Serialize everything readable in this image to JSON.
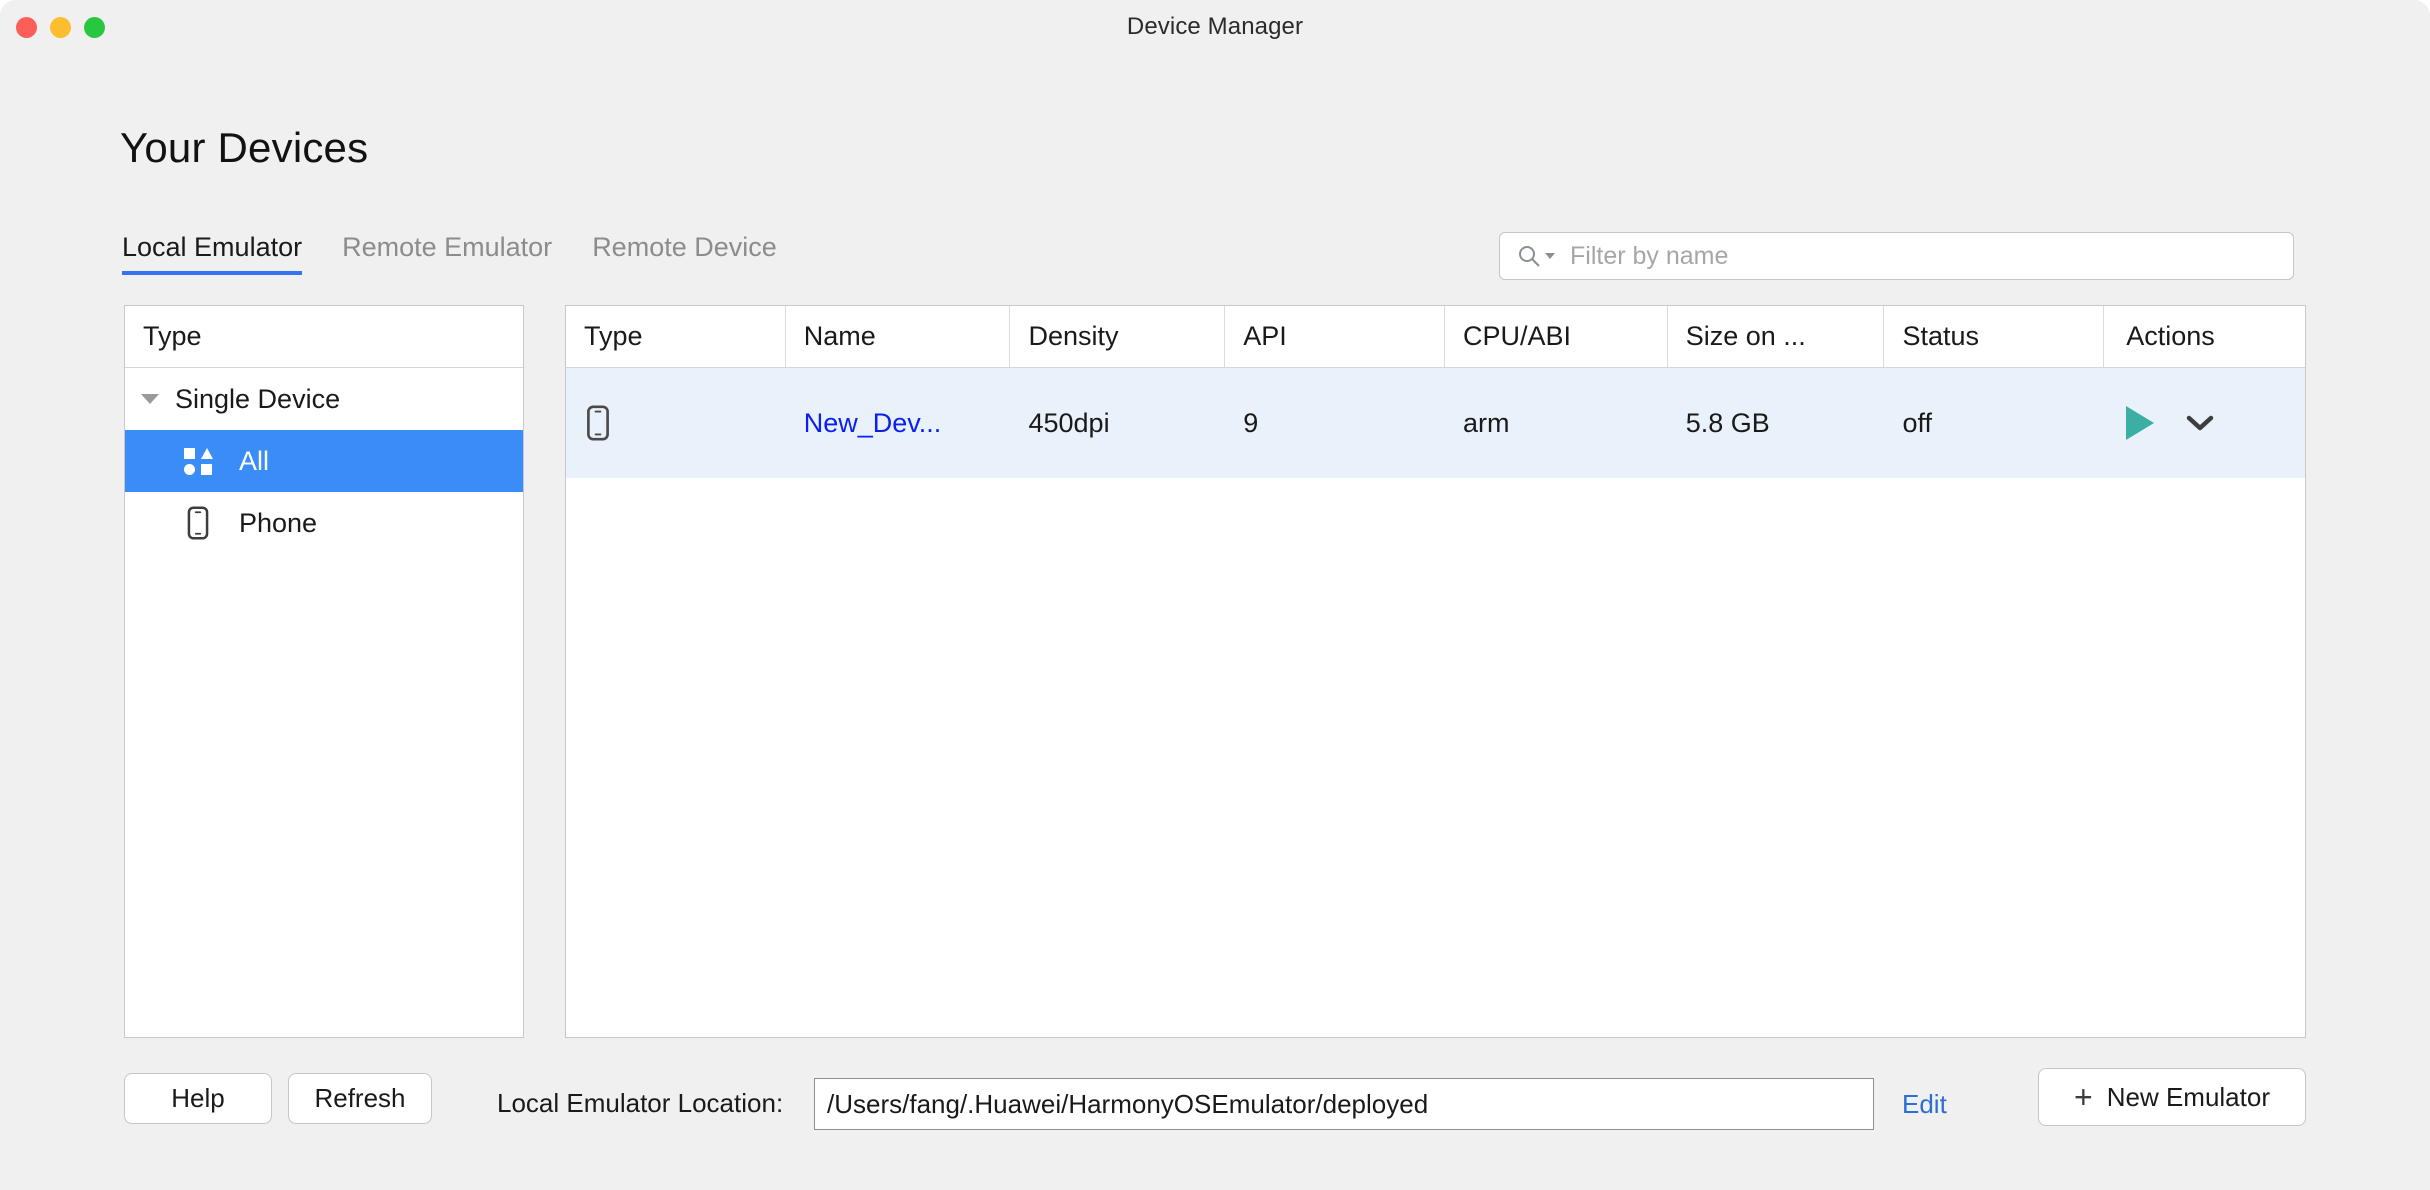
{
  "window": {
    "title": "Device Manager",
    "traffic_lights": [
      "close",
      "minimize",
      "maximize"
    ]
  },
  "page": {
    "heading": "Your Devices"
  },
  "tabs": [
    {
      "label": "Local Emulator",
      "active": true
    },
    {
      "label": "Remote Emulator",
      "active": false
    },
    {
      "label": "Remote Device",
      "active": false
    }
  ],
  "filter": {
    "placeholder": "Filter by name",
    "value": "",
    "icon": "search-icon"
  },
  "sidebar": {
    "header": "Type",
    "group": {
      "label": "Single Device",
      "expanded": true
    },
    "items": [
      {
        "label": "All",
        "icon": "all-shapes-icon",
        "selected": true
      },
      {
        "label": "Phone",
        "icon": "phone-icon",
        "selected": false
      }
    ]
  },
  "table": {
    "columns": [
      "Type",
      "Name",
      "Density",
      "API",
      "CPU/ABI",
      "Size on ...",
      "Status",
      "Actions"
    ],
    "rows": [
      {
        "type_icon": "phone-icon",
        "name": "New_Dev...",
        "density": "450dpi",
        "api": "9",
        "cpu_abi": "arm",
        "size_on_disk": "5.8 GB",
        "status": "off",
        "actions": {
          "run": "play-icon",
          "more": "chevron-down-icon"
        },
        "selected": true
      }
    ]
  },
  "footer": {
    "help_label": "Help",
    "refresh_label": "Refresh",
    "location_label": "Local Emulator Location:",
    "location_value": "/Users/fang/.Huawei/HarmonyOSEmulator/deployed",
    "edit_label": "Edit",
    "new_emulator_label": "New Emulator",
    "new_emulator_plus": "+"
  },
  "colors": {
    "accent_blue": "#3574f0",
    "selection_blue": "#3a8cf7",
    "row_selection": "#e9f1fb",
    "link_blue": "#0b20f0",
    "edit_link": "#2a6ed6",
    "play_teal": "#3bafa4",
    "window_bg": "#f0f0f0",
    "panel_bg": "#ffffff",
    "traffic_close": "#fc5f57",
    "traffic_min": "#fcbd2e",
    "traffic_max": "#27c840"
  }
}
